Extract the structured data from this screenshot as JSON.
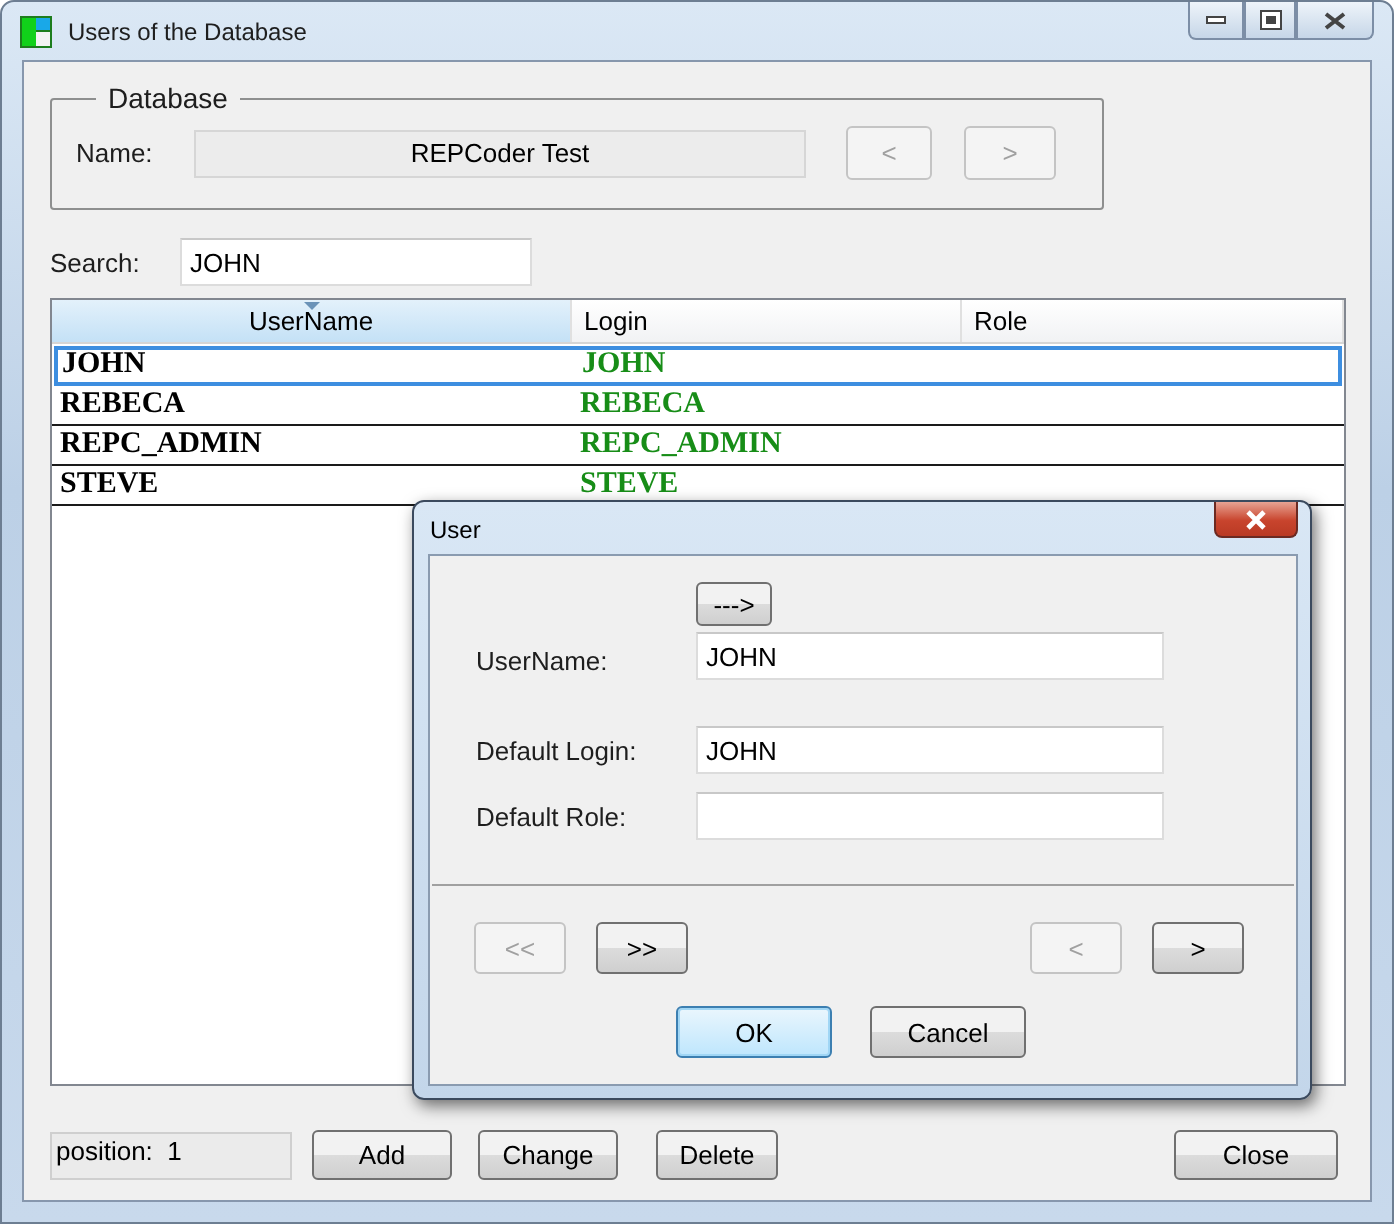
{
  "window": {
    "title": "Users of the Database"
  },
  "database": {
    "legend": "Database",
    "name_label": "Name:",
    "name_value": "REPCoder Test",
    "nav_buttons": [
      {
        "label": "<",
        "disabled": true
      },
      {
        "label": ">",
        "disabled": true
      }
    ]
  },
  "search": {
    "label": "Search:",
    "value": "JOHN"
  },
  "table": {
    "columns": [
      {
        "label": "UserName",
        "sorted": true
      },
      {
        "label": "Login",
        "sorted": false
      },
      {
        "label": "Role",
        "sorted": false
      }
    ],
    "rows": [
      {
        "username": "JOHN",
        "login": "JOHN",
        "selected": true
      },
      {
        "username": "REBECA",
        "login": "REBECA",
        "selected": false
      },
      {
        "username": "REPC_ADMIN",
        "login": "REPC_ADMIN",
        "selected": false
      },
      {
        "username": "STEVE",
        "login": "STEVE",
        "selected": false
      }
    ]
  },
  "status": {
    "position": "position:  1"
  },
  "buttons": [
    {
      "label": "Add"
    },
    {
      "label": "Change"
    },
    {
      "label": "Delete"
    }
  ],
  "close_button": {
    "label": "Close"
  },
  "dialog": {
    "title": "User",
    "copy_button": "--->",
    "fields": [
      {
        "label": "UserName:",
        "value": "JOHN"
      },
      {
        "label": "Default Login:",
        "value": "JOHN"
      },
      {
        "label": "Default Role:"
      }
    ],
    "nav_left": [
      {
        "label": "<<",
        "disabled": true
      },
      {
        "label": ">>",
        "disabled": false
      }
    ],
    "nav_right": [
      {
        "label": "<",
        "disabled": true
      },
      {
        "label": ">",
        "disabled": false
      }
    ],
    "ok": {
      "label": "OK",
      "default": true
    },
    "cancel": {
      "label": "Cancel",
      "default": false
    }
  }
}
